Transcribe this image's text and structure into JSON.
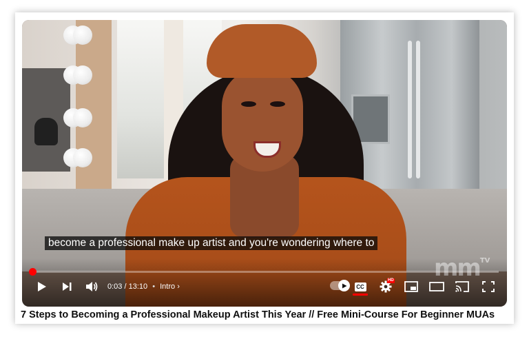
{
  "video": {
    "caption": "become a professional make up artist and you're wondering where to",
    "watermark": "mm",
    "watermark_sup": "TV",
    "title": "7 Steps to Becoming a Professional Makeup Artist This Year // Free Mini-Course For Beginner MUAs"
  },
  "controls": {
    "current_time": "0:03",
    "separator": "/",
    "duration": "13:10",
    "bullet": "•",
    "chapter": "Intro",
    "chapter_chevron": "›",
    "cc_label": "CC",
    "hd_badge": "HD",
    "progress_fraction": 0.004,
    "accent_color": "#ff0000",
    "icons": [
      "play-icon",
      "next-icon",
      "volume-icon",
      "autoplay-toggle",
      "cc-icon",
      "settings-icon",
      "miniplayer-icon",
      "theater-icon",
      "cast-icon",
      "fullscreen-icon"
    ]
  }
}
